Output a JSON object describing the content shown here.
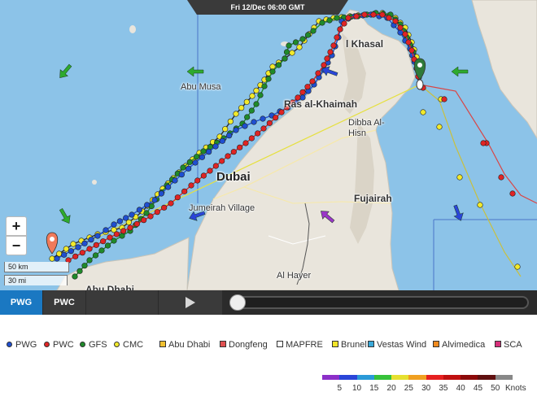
{
  "time_banner": "Fri 12/Dec 06:00 GMT",
  "places": [
    "Khasal",
    "Abu Musa",
    "Ras al-Khaimah",
    "Dibba Al-Hisn",
    "Dubai",
    "Fujairah",
    "Jumeirah Village",
    "Al Hayer",
    "Abu Dhabi"
  ],
  "map_controls": {
    "zoom_in": "+",
    "zoom_out": "−",
    "scale_km": "50 km",
    "scale_mi": "30 mi"
  },
  "tabs": {
    "pwg": "PWG",
    "pwc": "PWC",
    "active": "PWG"
  },
  "playback": {
    "progress": 0.0
  },
  "legend": [
    {
      "label": "PWG",
      "color": "#1f4fd1",
      "shape": "dot"
    },
    {
      "label": "PWC",
      "color": "#e02424",
      "shape": "dot"
    },
    {
      "label": "GFS",
      "color": "#1f8a2a",
      "shape": "dot"
    },
    {
      "label": "CMC",
      "color": "#f2ea2c",
      "shape": "dot"
    },
    {
      "label": "Abu Dhabi",
      "color": "#f0c030",
      "shape": "square"
    },
    {
      "label": "Dongfeng",
      "color": "#e05050",
      "shape": "square"
    },
    {
      "label": "MAPFRE",
      "color": "#ffffff",
      "shape": "square"
    },
    {
      "label": "Brunel",
      "color": "#f2e52a",
      "shape": "square"
    },
    {
      "label": "Vestas Wind",
      "color": "#3aa8d8",
      "shape": "square"
    },
    {
      "label": "Alvimedica",
      "color": "#f08a1e",
      "shape": "square"
    },
    {
      "label": "SCA",
      "color": "#d6307a",
      "shape": "square"
    }
  ],
  "speed_scale": {
    "labels": [
      "5",
      "10",
      "15",
      "20",
      "25",
      "30",
      "35",
      "40",
      "45",
      "50"
    ],
    "unit": "Knots",
    "colors": [
      "#8c2fc8",
      "#2a45d8",
      "#2a9ad8",
      "#36c23a",
      "#e6e030",
      "#f0a020",
      "#e62020",
      "#c01010",
      "#8c0a0a",
      "#601010",
      "#888888"
    ]
  },
  "colors": {
    "sea": "#8cc3e8",
    "land": "#e9e5dc",
    "controls": "#2b2b2b",
    "tab_active": "#1a78c2"
  }
}
